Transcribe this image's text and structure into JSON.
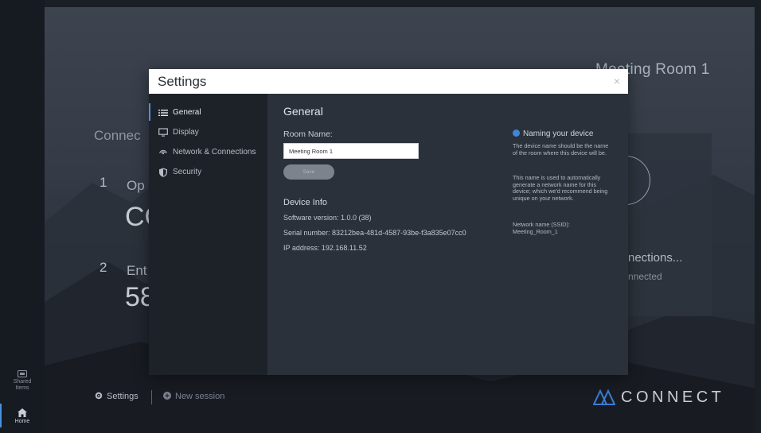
{
  "sidebar_rail": {
    "shared_items_label": "Shared\nItems",
    "home_label": "Home"
  },
  "background": {
    "room_title": "Meeting Room 1",
    "connect_heading": "Connec",
    "steps": [
      {
        "number": "1",
        "text": "Op",
        "big": "CC"
      },
      {
        "number": "2",
        "text": "Ent",
        "big": "58"
      }
    ],
    "panel": {
      "connections": "nections...",
      "connected": "nnected"
    },
    "footer": {
      "settings_label": "Settings",
      "new_session_label": "New session"
    },
    "brand": {
      "name": "CONNECT",
      "color": "#3a7bd5"
    }
  },
  "settings_dialog": {
    "title": "Settings",
    "close_label": "×",
    "nav": [
      {
        "label": "General",
        "icon": "list-icon",
        "active": true
      },
      {
        "label": "Display",
        "icon": "monitor-icon",
        "active": false
      },
      {
        "label": "Network & Connections",
        "icon": "wifi-icon",
        "active": false
      },
      {
        "label": "Security",
        "icon": "shield-icon",
        "active": false
      }
    ],
    "general": {
      "heading": "General",
      "room_name_label": "Room Name:",
      "room_name_value": "Meeting Room 1",
      "save_label": "Save",
      "device_info_heading": "Device Info",
      "software_version": "Software version:  1.0.0 (38)",
      "serial_number": "Serial number:  83212bea-481d-4587-93be-f3a835e07cc0",
      "ip_address": "IP address:  192.168.11.52"
    },
    "help": {
      "heading": "Naming your device",
      "paragraph_1": "The device name should be the name of the room where this device will be.",
      "paragraph_2": "This name is used to automatically generate a network name for this device; which we'd recommend being unique on your network.",
      "paragraph_3": "Network name (SSID):\nMeeting_Room_1"
    }
  },
  "colors": {
    "accent": "#4a90e2",
    "modal_bg": "#2b313b",
    "nav_bg": "#1d2229"
  }
}
